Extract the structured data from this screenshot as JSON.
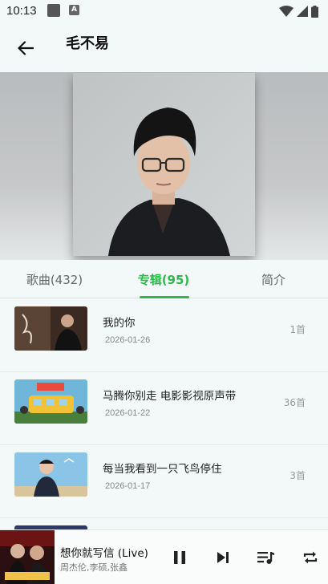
{
  "status_bar": {
    "time": "10:13",
    "a_label": "A"
  },
  "header": {
    "title": "毛不易"
  },
  "tabs": [
    {
      "label": "歌曲(432)",
      "active": false
    },
    {
      "label": "专辑(95)",
      "active": true
    },
    {
      "label": "简介",
      "active": false
    }
  ],
  "albums": [
    {
      "name": "我的你",
      "date": "2026-01-26",
      "count": "1首"
    },
    {
      "name": "马腾你别走 电影影视原声带",
      "date": "2026-01-22",
      "count": "36首"
    },
    {
      "name": "每当我看到一只飞鸟停住",
      "date": "2026-01-17",
      "count": "3首"
    }
  ],
  "player": {
    "song": "想你就写信 (Live)",
    "artist": "周杰伦,李硕,张鑫"
  },
  "colors": {
    "accent": "#2db84a",
    "background": "#f3f8f8"
  }
}
